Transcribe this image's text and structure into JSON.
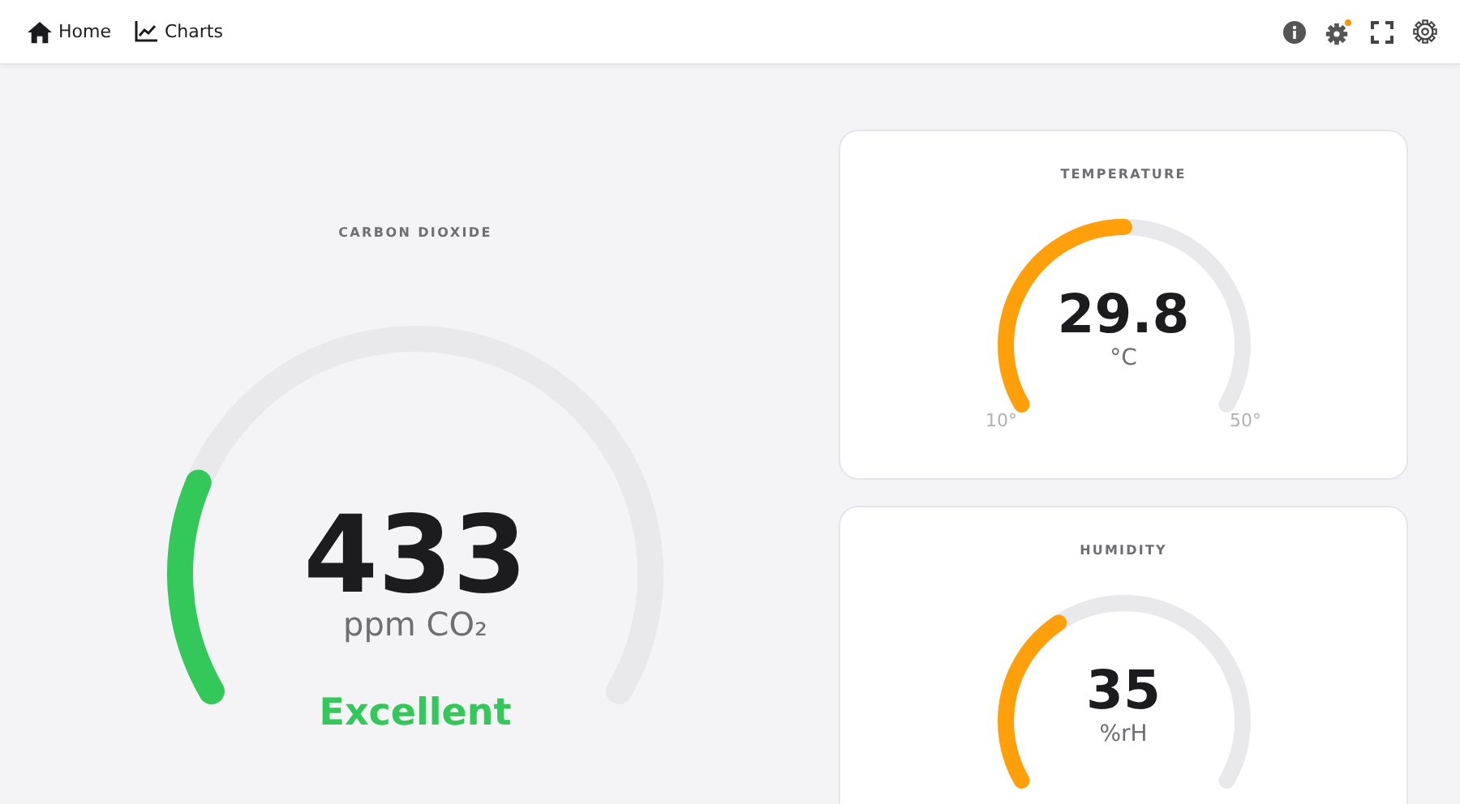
{
  "nav": [
    {
      "label": "Home"
    },
    {
      "label": "Charts"
    }
  ],
  "toolbar": [
    {
      "badge": false
    },
    {
      "badge": true
    },
    {
      "badge": false
    },
    {
      "badge": false
    }
  ],
  "main_gauge": {
    "title": "CARBON DIOXIDE",
    "value": "433",
    "unit": "ppm CO₂",
    "color": "#34c759",
    "status": "Excellent"
  },
  "cards": [
    {
      "title": "TEMPERATURE",
      "value": "29.8",
      "unit": "°C",
      "color": "#ff9f0a",
      "min": "10°",
      "max": "50°"
    },
    {
      "title": "HUMIDITY",
      "value": "35",
      "unit": "%rH",
      "color": "#ff9f0a"
    }
  ]
}
